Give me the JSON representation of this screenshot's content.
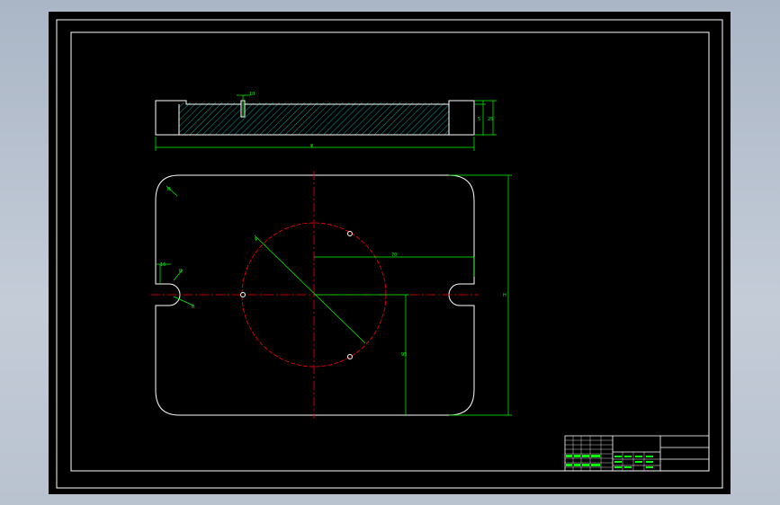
{
  "drawing": {
    "dim_labels": {
      "top_hole": "10",
      "overall_width_top": "φ",
      "corner_radius": "R",
      "circle_diameter": "φ",
      "horizontal_offset": "70",
      "vertical_offset": "95",
      "overall_height": "H",
      "slot_width": "16",
      "slot_r1": "R",
      "slot_r2": "R",
      "thk_a": "5",
      "thk_b": "25"
    }
  },
  "colors": {
    "background": "#000000",
    "outline": "#ffffff",
    "dimension": "#00ff00",
    "centerline": "#ff0000",
    "hatch": "#00cccc"
  }
}
